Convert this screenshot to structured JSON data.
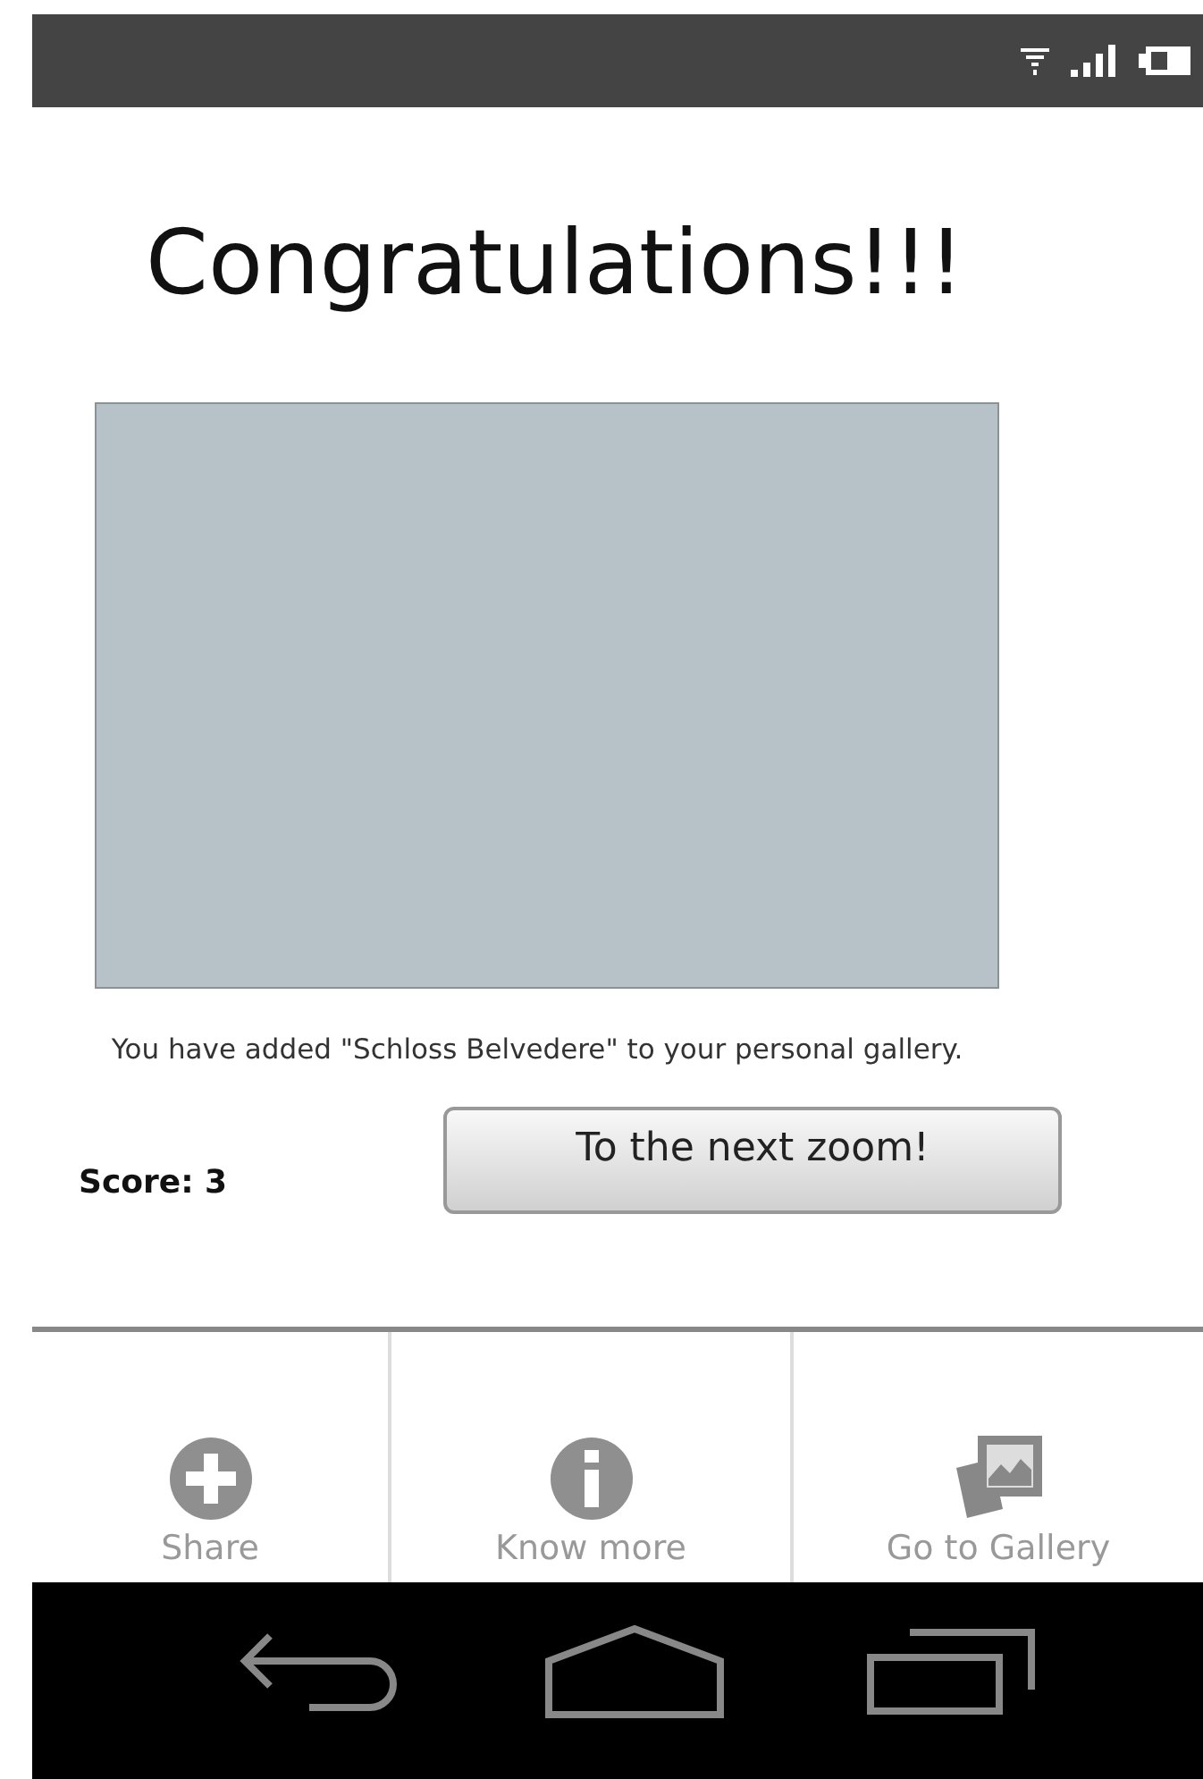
{
  "title": "Congratulations!!!",
  "message": "You have added \"Schloss Belvedere\" to your personal gallery.",
  "score": "Score: 3",
  "next_button": "To the next zoom!",
  "actions": [
    {
      "kind": "plus",
      "label": "Share"
    },
    {
      "kind": "info",
      "label": "Know more"
    },
    {
      "kind": "gallery",
      "label": "Go to Gallery"
    }
  ]
}
